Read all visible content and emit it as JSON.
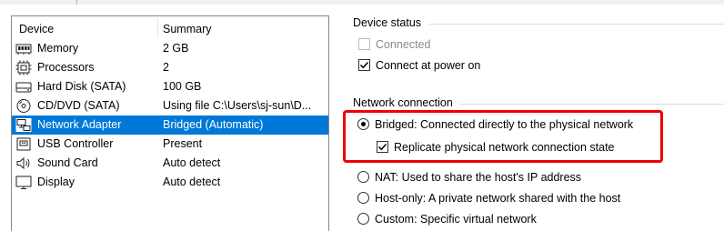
{
  "device_list": {
    "columns": {
      "device": "Device",
      "summary": "Summary"
    },
    "rows": [
      {
        "icon": "memory-icon",
        "device": "Memory",
        "summary": "2 GB",
        "selected": false
      },
      {
        "icon": "processor-icon",
        "device": "Processors",
        "summary": "2",
        "selected": false
      },
      {
        "icon": "hard-disk-icon",
        "device": "Hard Disk (SATA)",
        "summary": "100 GB",
        "selected": false
      },
      {
        "icon": "cd-dvd-icon",
        "device": "CD/DVD (SATA)",
        "summary": "Using file C:\\Users\\sj-sun\\D...",
        "selected": false
      },
      {
        "icon": "network-adapter-icon",
        "device": "Network Adapter",
        "summary": "Bridged (Automatic)",
        "selected": true
      },
      {
        "icon": "usb-icon",
        "device": "USB Controller",
        "summary": "Present",
        "selected": false
      },
      {
        "icon": "sound-icon",
        "device": "Sound Card",
        "summary": "Auto detect",
        "selected": false
      },
      {
        "icon": "display-icon",
        "device": "Display",
        "summary": "Auto detect",
        "selected": false
      }
    ]
  },
  "device_status": {
    "title": "Device status",
    "connected": {
      "label": "Connected",
      "checked": false,
      "disabled": true
    },
    "connect_at_power_on": {
      "label": "Connect at power on",
      "checked": true,
      "disabled": false
    }
  },
  "network_connection": {
    "title": "Network connection",
    "bridged": {
      "label": "Bridged: Connected directly to the physical network",
      "selected": true
    },
    "replicate": {
      "label": "Replicate physical network connection state",
      "checked": true
    },
    "nat": {
      "label": "NAT: Used to share the host's IP address",
      "selected": false
    },
    "host_only": {
      "label": "Host-only: A private network shared with the host",
      "selected": false
    },
    "custom": {
      "label": "Custom: Specific virtual network",
      "selected": false
    }
  },
  "colors": {
    "selection": "#0078d7",
    "highlight_border": "#ee0000"
  }
}
